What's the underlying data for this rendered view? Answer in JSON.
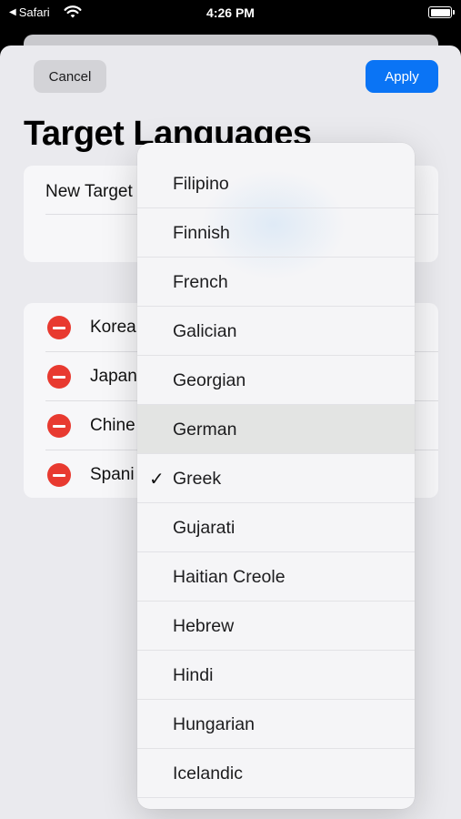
{
  "status_bar": {
    "back_label": "Safari",
    "time": "4:26 PM"
  },
  "toolbar": {
    "cancel_label": "Cancel",
    "apply_label": "Apply"
  },
  "page": {
    "title": "Target Languages",
    "new_target_label": "New Target"
  },
  "languages": [
    {
      "name": "Korea"
    },
    {
      "name": "Japan"
    },
    {
      "name": "Chine"
    },
    {
      "name": "Spani"
    }
  ],
  "menu": {
    "selected": "Greek",
    "highlighted": "German",
    "items": [
      {
        "label": "Filipino"
      },
      {
        "label": "Finnish"
      },
      {
        "label": "French"
      },
      {
        "label": "Galician"
      },
      {
        "label": "Georgian"
      },
      {
        "label": "German"
      },
      {
        "label": "Greek",
        "check": "✓"
      },
      {
        "label": "Gujarati"
      },
      {
        "label": "Haitian Creole"
      },
      {
        "label": "Hebrew"
      },
      {
        "label": "Hindi"
      },
      {
        "label": "Hungarian"
      },
      {
        "label": "Icelandic"
      }
    ]
  },
  "colors": {
    "accent": "#0a74f5",
    "delete": "#e83a30",
    "highlight": "#e3e4e3"
  }
}
